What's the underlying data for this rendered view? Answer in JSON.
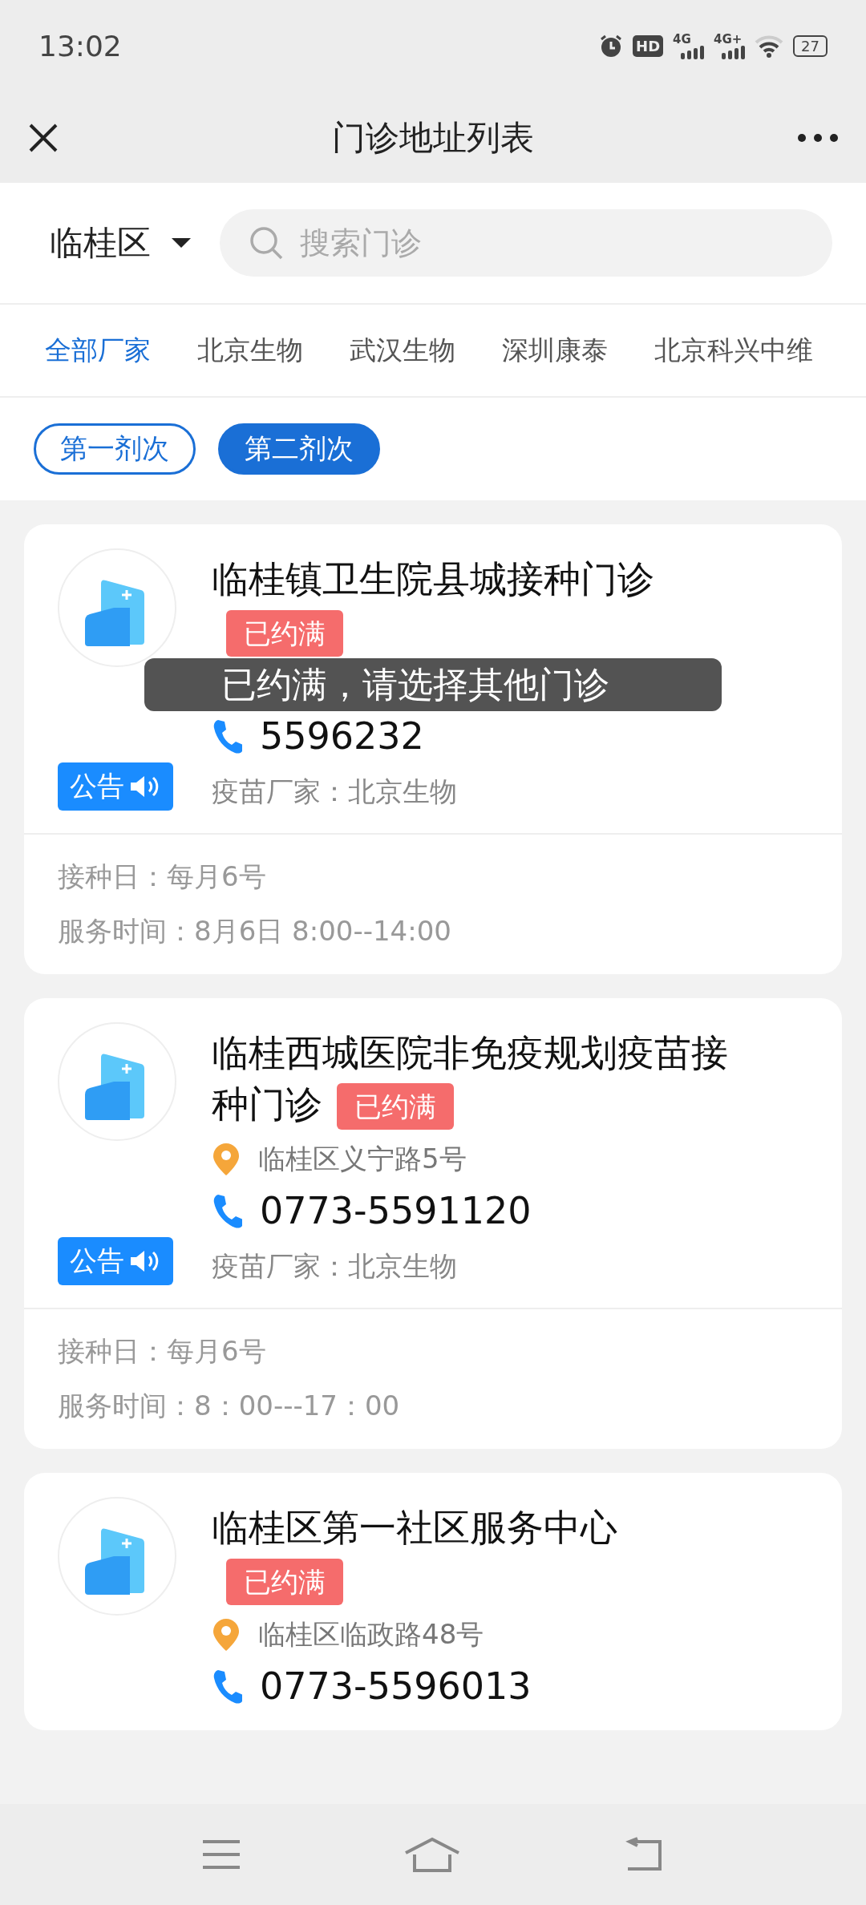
{
  "status_bar": {
    "time": "13:02",
    "hd": "HD",
    "networks": [
      "4G",
      "4G+"
    ],
    "battery": "27"
  },
  "header": {
    "title": "门诊地址列表"
  },
  "filter": {
    "district": "临桂区",
    "search_placeholder": "搜索门诊"
  },
  "vendor_tabs": [
    {
      "label": "全部厂家",
      "selected": true
    },
    {
      "label": "北京生物",
      "selected": false
    },
    {
      "label": "武汉生物",
      "selected": false
    },
    {
      "label": "深圳康泰",
      "selected": false
    },
    {
      "label": "北京科兴中维",
      "selected": false
    }
  ],
  "dose_chips": [
    {
      "label": "第一剂次",
      "selected": false
    },
    {
      "label": "第二剂次",
      "selected": true
    }
  ],
  "clinics": [
    {
      "name": "临桂镇卫生院县城接种门诊",
      "badge": "已约满",
      "phone": "5596232",
      "notice": "公告",
      "vendor": "疫苗厂家：北京生物",
      "details": [
        "接种日：每月6号",
        "服务时间：8月6日 8:00--14:00"
      ]
    },
    {
      "name": "临桂西城医院非免疫规划疫苗接种门诊",
      "badge": "已约满",
      "address": "临桂区义宁路5号",
      "phone": "0773-5591120",
      "notice": "公告",
      "vendor": "疫苗厂家：北京生物",
      "details": [
        "接种日：每月6号",
        "服务时间：8：00---17：00"
      ]
    },
    {
      "name": "临桂区第一社区服务中心",
      "badge": "已约满",
      "address": "临桂区临政路48号",
      "phone": "0773-5596013"
    }
  ],
  "toast": {
    "message": "已约满，请选择其他门诊"
  }
}
